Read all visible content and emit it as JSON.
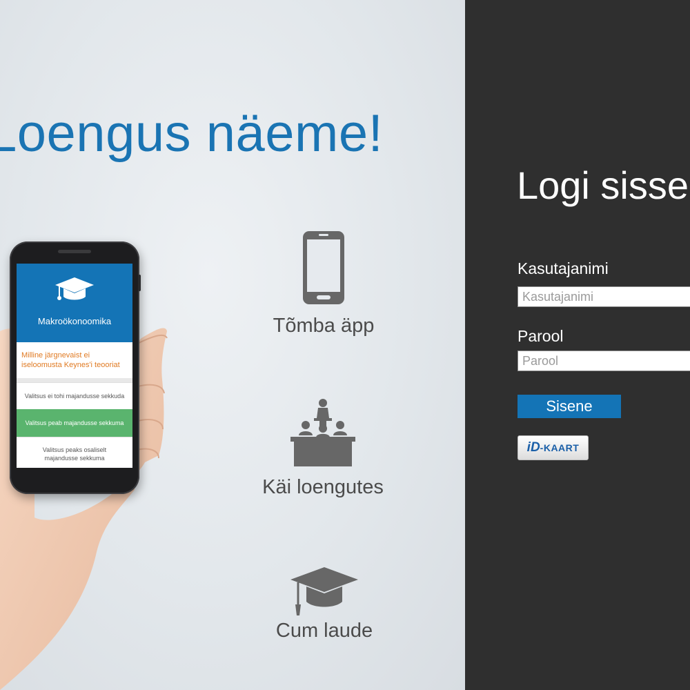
{
  "hero": {
    "title": "Loengus näeme!",
    "features": [
      {
        "icon": "smartphone-icon",
        "label": "Tõmba äpp"
      },
      {
        "icon": "lecture-icon",
        "label": "Käi loengutes"
      },
      {
        "icon": "graduation-cap-icon",
        "label": "Cum laude"
      }
    ],
    "phone": {
      "course": "Makroökonoomika",
      "question": "Milline järgnevaist ei iseloomusta Keynes'i teooriat",
      "options": [
        "Valitsus ei tohi majandusse sekkuda",
        "Valitsus peab majandusse sekkuma",
        "Valitsus peaks osaliselt majandusse sekkuma"
      ],
      "selected_option": 1
    }
  },
  "login": {
    "title": "Logi sisse",
    "username_label": "Kasutajanimi",
    "username_placeholder": "Kasutajanimi",
    "username_value": "",
    "password_label": "Parool",
    "password_placeholder": "Parool",
    "password_value": "",
    "submit_label": "Sisene",
    "idcard": {
      "logo": "iD",
      "text": "-KAART"
    }
  },
  "colors": {
    "accent": "#1474b6",
    "panel_background": "#2f2f2f",
    "question_text": "#e07a22",
    "selected_option": "#5ab46e"
  }
}
